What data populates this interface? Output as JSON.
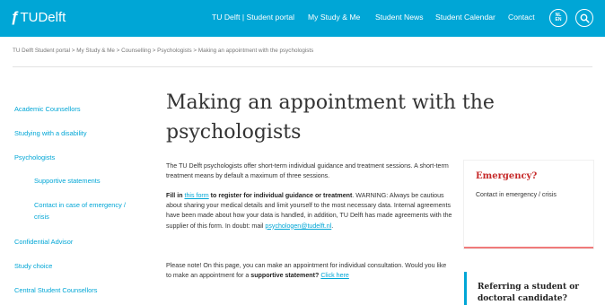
{
  "header": {
    "logo_flame": "ƒ",
    "logo_text": "TUDelft",
    "nav": [
      "TU Delft | Student portal",
      "My Study & Me",
      "Student News",
      "Student Calendar",
      "Contact"
    ],
    "lang_top": "NL",
    "lang_bottom": "EN",
    "search_icon": "search-icon"
  },
  "breadcrumb": "TU Delft Student portal  >  My Study & Me  >  Counselling  >  Psychologists  >  Making an appointment with the psychologists",
  "sidebar": {
    "items": [
      "Academic Counsellors",
      "Studying with a disability",
      "Psychologists",
      "Supportive statements",
      "Contact in case of emergency /",
      "crisis",
      "Confidential Advisor",
      "Study choice",
      "Central Student Counsellors"
    ]
  },
  "main": {
    "title_line1": "Making an appointment with the",
    "title_line2": "psychologists",
    "intro": "The TU Delft psychologists offer short-term individual guidance and treatment sessions. A short-term treatment means by default a maximum of three sessions.",
    "fill_prefix": "Fill in ",
    "fill_link": "this form",
    "fill_bold": " to register for individual guidance or treatment",
    "fill_rest": ". WARNING: Always be cautious about sharing your medical details and limit yourself to the most necessary data. Internal agreements have been made about how your data is handled, in addition, TU Delft has made agreements with the supplier of this form. In doubt: mail ",
    "fill_email": "psychologen@tudelft.nl",
    "fill_end": ".",
    "note_prefix": "Please note! On this page, you can make an appointment for individual consultation. Would you like to make an appointment for a ",
    "note_bold": "supportive statement?",
    "note_link": "Click here"
  },
  "emergency": {
    "title": "Emergency?",
    "text": "Contact in emergency / crisis"
  },
  "referring": {
    "title_line1": "Referring a student or",
    "title_line2": "doctoral candidate?"
  },
  "colors": {
    "brand": "#00a6d6",
    "emergency": "#c62a2a"
  }
}
